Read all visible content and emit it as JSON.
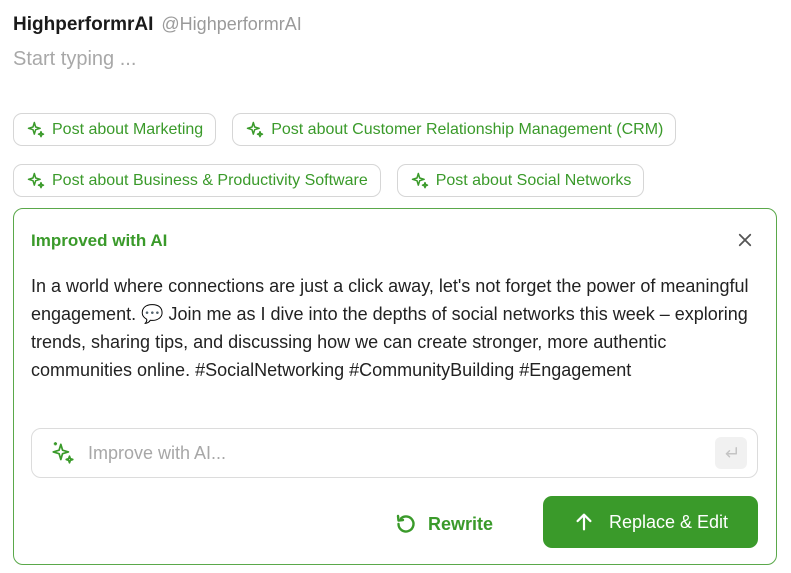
{
  "account": {
    "name": "HighperformrAI",
    "handle": "@HighperformrAI"
  },
  "composer": {
    "placeholder": "Start typing ..."
  },
  "suggestions": [
    {
      "label": "Post about Marketing",
      "icon": "sparkles-icon"
    },
    {
      "label": "Post about Customer Relationship Management (CRM)",
      "icon": "sparkles-icon"
    },
    {
      "label": "Post about Business & Productivity Software",
      "icon": "sparkles-icon"
    },
    {
      "label": "Post about Social Networks",
      "icon": "sparkles-icon"
    }
  ],
  "ai_panel": {
    "title": "Improved with AI",
    "close_icon": "close-icon",
    "text": "In a world where connections are just a click away, let's not forget the power of meaningful engagement. 💬 Join me as I dive into the depths of social networks this week – exploring trends, sharing tips, and discussing how we can create stronger, more authentic communities online. #SocialNetworking #CommunityBuilding #Engagement",
    "improve": {
      "placeholder": "Improve with AI...",
      "value": ""
    },
    "rewrite_label": "Rewrite",
    "replace_label": "Replace & Edit"
  },
  "colors": {
    "accent": "#3a9a2a",
    "border": "#5aa84a",
    "muted": "#a8a8a8"
  }
}
